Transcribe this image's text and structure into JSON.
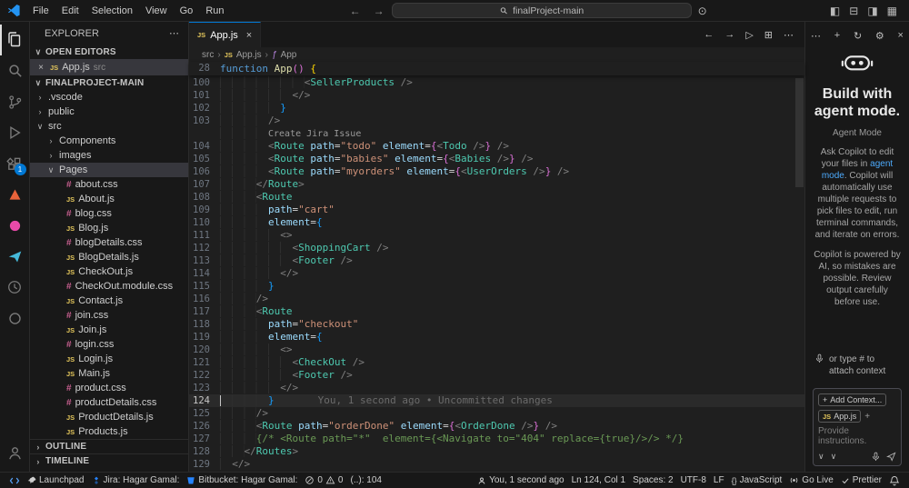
{
  "glyphs": {
    "js": "JS",
    "css": "#",
    "close": "×",
    "more": "⋯",
    "chev_down": "∨",
    "chev_right": "›",
    "back": "←",
    "fwd": "→",
    "plus": "+",
    "copilot": "⊙"
  },
  "titlebar": {
    "menus": [
      "File",
      "Edit",
      "Selection",
      "View",
      "Go",
      "Run"
    ],
    "search_value": "finalProject-main",
    "layout_icons": [
      {
        "id": "toggle-sidebar",
        "g": "◧"
      },
      {
        "id": "toggle-panel",
        "g": "⊟"
      },
      {
        "id": "toggle-secondary-sidebar",
        "g": "◨"
      },
      {
        "id": "customize-layout",
        "g": "▦"
      }
    ]
  },
  "activitybar": {
    "items": [
      {
        "id": "explorer",
        "icon": "files",
        "active": true
      },
      {
        "id": "search",
        "icon": "search"
      },
      {
        "id": "source-control",
        "icon": "scm"
      },
      {
        "id": "run-and-debug",
        "icon": "debug"
      },
      {
        "id": "extensions",
        "icon": "extensions",
        "badge": "1"
      },
      {
        "id": "jira",
        "icon": "tri",
        "color": "#e8633a"
      },
      {
        "id": "pink-extension",
        "icon": "dot",
        "color": "#ea4aaa"
      },
      {
        "id": "rest-client",
        "icon": "plane",
        "color": "#45b8d8"
      },
      {
        "id": "clock-extension",
        "icon": "clock"
      },
      {
        "id": "circle-extension",
        "icon": "ring"
      }
    ],
    "bottom": [
      {
        "id": "account",
        "icon": "account"
      }
    ]
  },
  "explorer": {
    "title": "EXPLORER",
    "open_editors_label": "OPEN EDITORS",
    "open_editors": [
      {
        "name": "App.js",
        "detail": "src",
        "icon": "js",
        "active": true
      }
    ],
    "project_label": "FINALPROJECT-MAIN",
    "tree": [
      {
        "label": ".vscode",
        "kind": "folder",
        "level": 0
      },
      {
        "label": "public",
        "kind": "folder",
        "level": 0
      },
      {
        "label": "src",
        "kind": "folder",
        "level": 0,
        "expanded": true
      },
      {
        "label": "Components",
        "kind": "folder",
        "level": 1
      },
      {
        "label": "images",
        "kind": "folder",
        "level": 1
      },
      {
        "label": "Pages",
        "kind": "folder",
        "level": 1,
        "expanded": true,
        "selected": true
      },
      {
        "label": "about.css",
        "kind": "css",
        "level": 2
      },
      {
        "label": "About.js",
        "kind": "js",
        "level": 2
      },
      {
        "label": "blog.css",
        "kind": "css",
        "level": 2
      },
      {
        "label": "Blog.js",
        "kind": "js",
        "level": 2
      },
      {
        "label": "blogDetails.css",
        "kind": "css",
        "level": 2
      },
      {
        "label": "BlogDetails.js",
        "kind": "js",
        "level": 2
      },
      {
        "label": "CheckOut.js",
        "kind": "js",
        "level": 2
      },
      {
        "label": "CheckOut.module.css",
        "kind": "css",
        "level": 2
      },
      {
        "label": "Contact.js",
        "kind": "js",
        "level": 2
      },
      {
        "label": "join.css",
        "kind": "css",
        "level": 2
      },
      {
        "label": "Join.js",
        "kind": "js",
        "level": 2
      },
      {
        "label": "login.css",
        "kind": "css",
        "level": 2
      },
      {
        "label": "Login.js",
        "kind": "js",
        "level": 2
      },
      {
        "label": "Main.js",
        "kind": "js",
        "level": 2
      },
      {
        "label": "product.css",
        "kind": "css",
        "level": 2
      },
      {
        "label": "productDetails.css",
        "kind": "css",
        "level": 2
      },
      {
        "label": "ProductDetails.js",
        "kind": "js",
        "level": 2
      },
      {
        "label": "Products.js",
        "kind": "js",
        "level": 2
      }
    ],
    "outline_label": "OUTLINE",
    "timeline_label": "TIMELINE"
  },
  "editor": {
    "tab": {
      "name": "App.js"
    },
    "actions": [
      {
        "id": "nav-back",
        "g": "←"
      },
      {
        "id": "nav-forward",
        "g": "→"
      },
      {
        "id": "run",
        "g": "▷"
      },
      {
        "id": "split-editor",
        "g": "⊞"
      },
      {
        "id": "more-actions",
        "g": "⋯"
      }
    ],
    "breadcrumb": [
      {
        "label": "src"
      },
      {
        "label": "App.js",
        "icon": "js"
      },
      {
        "label": "App",
        "icon": "symbol"
      }
    ],
    "sticky": {
      "num": "28",
      "tokens": [
        {
          "t": "function",
          "c": "kw"
        },
        {
          "t": " ",
          "c": "pl"
        },
        {
          "t": "App",
          "c": "fn"
        },
        {
          "t": "()",
          "c": "b2"
        },
        {
          "t": " ",
          "c": "pl"
        },
        {
          "t": "{",
          "c": "b1"
        }
      ]
    },
    "codelens": "Create Jira Issue",
    "blame": "You, 1 second ago • Uncommitted changes",
    "lines": [
      {
        "n": "100",
        "tk": [
          {
            "t": "              <",
            "c": "pu"
          },
          {
            "t": "SellerProducts",
            "c": "cp"
          },
          {
            "t": " />",
            "c": "pu"
          }
        ]
      },
      {
        "n": "101",
        "tk": [
          {
            "t": "            </>",
            "c": "pu"
          }
        ]
      },
      {
        "n": "102",
        "tk": [
          {
            "t": "          ",
            "c": "pl"
          },
          {
            "t": "}",
            "c": "b3"
          }
        ]
      },
      {
        "n": "103",
        "tk": [
          {
            "t": "        />",
            "c": "pu"
          }
        ]
      },
      {
        "lens": true
      },
      {
        "n": "104",
        "tk": [
          {
            "t": "        <",
            "c": "pu"
          },
          {
            "t": "Route",
            "c": "cp"
          },
          {
            "t": " ",
            "c": "pl"
          },
          {
            "t": "path",
            "c": "at"
          },
          {
            "t": "=",
            "c": "pl"
          },
          {
            "t": "\"todo\"",
            "c": "st"
          },
          {
            "t": " ",
            "c": "pl"
          },
          {
            "t": "element",
            "c": "at"
          },
          {
            "t": "=",
            "c": "pl"
          },
          {
            "t": "{",
            "c": "b2"
          },
          {
            "t": "<",
            "c": "pu"
          },
          {
            "t": "Todo",
            "c": "cp"
          },
          {
            "t": " />",
            "c": "pu"
          },
          {
            "t": "}",
            "c": "b2"
          },
          {
            "t": " />",
            "c": "pu"
          }
        ]
      },
      {
        "n": "105",
        "tk": [
          {
            "t": "        <",
            "c": "pu"
          },
          {
            "t": "Route",
            "c": "cp"
          },
          {
            "t": " ",
            "c": "pl"
          },
          {
            "t": "path",
            "c": "at"
          },
          {
            "t": "=",
            "c": "pl"
          },
          {
            "t": "\"babies\"",
            "c": "st"
          },
          {
            "t": " ",
            "c": "pl"
          },
          {
            "t": "element",
            "c": "at"
          },
          {
            "t": "=",
            "c": "pl"
          },
          {
            "t": "{",
            "c": "b2"
          },
          {
            "t": "<",
            "c": "pu"
          },
          {
            "t": "Babies",
            "c": "cp"
          },
          {
            "t": " />",
            "c": "pu"
          },
          {
            "t": "}",
            "c": "b2"
          },
          {
            "t": " />",
            "c": "pu"
          }
        ]
      },
      {
        "n": "106",
        "tk": [
          {
            "t": "        <",
            "c": "pu"
          },
          {
            "t": "Route",
            "c": "cp"
          },
          {
            "t": " ",
            "c": "pl"
          },
          {
            "t": "path",
            "c": "at"
          },
          {
            "t": "=",
            "c": "pl"
          },
          {
            "t": "\"myorders\"",
            "c": "st"
          },
          {
            "t": " ",
            "c": "pl"
          },
          {
            "t": "element",
            "c": "at"
          },
          {
            "t": "=",
            "c": "pl"
          },
          {
            "t": "{",
            "c": "b2"
          },
          {
            "t": "<",
            "c": "pu"
          },
          {
            "t": "UserOrders",
            "c": "cp"
          },
          {
            "t": " />",
            "c": "pu"
          },
          {
            "t": "}",
            "c": "b2"
          },
          {
            "t": " />",
            "c": "pu"
          }
        ]
      },
      {
        "n": "107",
        "tk": [
          {
            "t": "      </",
            "c": "pu"
          },
          {
            "t": "Route",
            "c": "cp"
          },
          {
            "t": ">",
            "c": "pu"
          }
        ]
      },
      {
        "n": "108",
        "tk": [
          {
            "t": "      <",
            "c": "pu"
          },
          {
            "t": "Route",
            "c": "cp"
          }
        ]
      },
      {
        "n": "109",
        "tk": [
          {
            "t": "        ",
            "c": "pl"
          },
          {
            "t": "path",
            "c": "at"
          },
          {
            "t": "=",
            "c": "pl"
          },
          {
            "t": "\"cart\"",
            "c": "st"
          }
        ]
      },
      {
        "n": "110",
        "tk": [
          {
            "t": "        ",
            "c": "pl"
          },
          {
            "t": "element",
            "c": "at"
          },
          {
            "t": "=",
            "c": "pl"
          },
          {
            "t": "{",
            "c": "b3"
          }
        ]
      },
      {
        "n": "111",
        "tk": [
          {
            "t": "          <>",
            "c": "pu"
          }
        ]
      },
      {
        "n": "112",
        "tk": [
          {
            "t": "            <",
            "c": "pu"
          },
          {
            "t": "ShoppingCart",
            "c": "cp"
          },
          {
            "t": " />",
            "c": "pu"
          }
        ]
      },
      {
        "n": "113",
        "tk": [
          {
            "t": "            <",
            "c": "pu"
          },
          {
            "t": "Footer",
            "c": "cp"
          },
          {
            "t": " />",
            "c": "pu"
          }
        ]
      },
      {
        "n": "114",
        "tk": [
          {
            "t": "          </>",
            "c": "pu"
          }
        ]
      },
      {
        "n": "115",
        "tk": [
          {
            "t": "        ",
            "c": "pl"
          },
          {
            "t": "}",
            "c": "b3"
          }
        ]
      },
      {
        "n": "116",
        "tk": [
          {
            "t": "      />",
            "c": "pu"
          }
        ]
      },
      {
        "n": "117",
        "tk": [
          {
            "t": "      <",
            "c": "pu"
          },
          {
            "t": "Route",
            "c": "cp"
          }
        ]
      },
      {
        "n": "118",
        "tk": [
          {
            "t": "        ",
            "c": "pl"
          },
          {
            "t": "path",
            "c": "at"
          },
          {
            "t": "=",
            "c": "pl"
          },
          {
            "t": "\"checkout\"",
            "c": "st"
          }
        ]
      },
      {
        "n": "119",
        "tk": [
          {
            "t": "        ",
            "c": "pl"
          },
          {
            "t": "element",
            "c": "at"
          },
          {
            "t": "=",
            "c": "pl"
          },
          {
            "t": "{",
            "c": "b3"
          }
        ]
      },
      {
        "n": "120",
        "tk": [
          {
            "t": "          <>",
            "c": "pu"
          }
        ]
      },
      {
        "n": "121",
        "tk": [
          {
            "t": "            <",
            "c": "pu"
          },
          {
            "t": "CheckOut",
            "c": "cp"
          },
          {
            "t": " />",
            "c": "pu"
          }
        ]
      },
      {
        "n": "122",
        "tk": [
          {
            "t": "            <",
            "c": "pu"
          },
          {
            "t": "Footer",
            "c": "cp"
          },
          {
            "t": " />",
            "c": "pu"
          }
        ]
      },
      {
        "n": "123",
        "tk": [
          {
            "t": "          </>",
            "c": "pu"
          }
        ]
      },
      {
        "n": "124",
        "cur": true,
        "blame": true,
        "tk": [
          {
            "t": "        ",
            "c": "pl"
          },
          {
            "t": "}",
            "c": "b3"
          }
        ]
      },
      {
        "n": "125",
        "tk": [
          {
            "t": "      />",
            "c": "pu"
          }
        ]
      },
      {
        "n": "126",
        "tk": [
          {
            "t": "      <",
            "c": "pu"
          },
          {
            "t": "Route",
            "c": "cp"
          },
          {
            "t": " ",
            "c": "pl"
          },
          {
            "t": "path",
            "c": "at"
          },
          {
            "t": "=",
            "c": "pl"
          },
          {
            "t": "\"orderDone\"",
            "c": "st"
          },
          {
            "t": " ",
            "c": "pl"
          },
          {
            "t": "element",
            "c": "at"
          },
          {
            "t": "=",
            "c": "pl"
          },
          {
            "t": "{",
            "c": "b2"
          },
          {
            "t": "<",
            "c": "pu"
          },
          {
            "t": "OrderDone",
            "c": "cp"
          },
          {
            "t": " />",
            "c": "pu"
          },
          {
            "t": "}",
            "c": "b2"
          },
          {
            "t": " />",
            "c": "pu"
          }
        ]
      },
      {
        "n": "127",
        "tk": [
          {
            "t": "      ",
            "c": "pl"
          },
          {
            "t": "{/* <Route path=\"*\"  element={<Navigate to=\"404\" replace={true}/>/> */}",
            "c": "cm"
          }
        ]
      },
      {
        "n": "128",
        "tk": [
          {
            "t": "    </",
            "c": "pu"
          },
          {
            "t": "Routes",
            "c": "cp"
          },
          {
            "t": ">",
            "c": "pu"
          }
        ]
      },
      {
        "n": "129",
        "tk": [
          {
            "t": "  </>",
            "c": "pu"
          }
        ]
      }
    ]
  },
  "copilot": {
    "header_icons": [
      {
        "id": "more-actions",
        "g": "⋯"
      },
      {
        "id": "new-chat",
        "g": "+"
      },
      {
        "id": "chat-history",
        "g": "↻"
      },
      {
        "id": "settings",
        "g": "⚙"
      },
      {
        "id": "close-panel",
        "g": "×"
      }
    ],
    "title_line1": "Build with",
    "title_line2": "agent mode.",
    "subtitle": "Agent Mode",
    "p1_pre": "Ask Copilot to edit your files in ",
    "p1_link": "agent mode",
    "p1_post": ". Copilot will automatically use multiple requests to pick files to edit, run terminal commands, and iterate on errors.",
    "p2": "Copilot is powered by AI, so mistakes are possible. Review output carefully before use.",
    "hint": "or type # to attach context",
    "add_context": "Add Context...",
    "file_chip": "App.js",
    "placeholder": "Provide instructions.",
    "accent": "#4daafc"
  },
  "statusbar": {
    "left": [
      {
        "id": "remote",
        "icon": "remote"
      },
      {
        "id": "launchpad",
        "icon": "rocket",
        "text": "Launchpad"
      },
      {
        "id": "jira",
        "icon": "jira",
        "text": "Jira: Hagar Gamal:"
      },
      {
        "id": "bitbucket",
        "icon": "bitbucket",
        "text": "Bitbucket: Hagar Gamal:"
      },
      {
        "id": "problems",
        "icon": "error",
        "text": "0",
        "icon2": "warn",
        "text2": "0"
      },
      {
        "id": "counter",
        "text": "(..): 104"
      }
    ],
    "right": [
      {
        "id": "git-blame",
        "icon": "person",
        "text": "You, 1 second ago"
      },
      {
        "id": "cursor-position",
        "text": "Ln 124, Col 1"
      },
      {
        "id": "indentation",
        "text": "Spaces: 2"
      },
      {
        "id": "encoding",
        "text": "UTF-8"
      },
      {
        "id": "eol",
        "text": "LF"
      },
      {
        "id": "language",
        "icon": "braces",
        "text": "JavaScript"
      },
      {
        "id": "go-live",
        "icon": "broadcast",
        "text": "Go Live"
      },
      {
        "id": "prettier",
        "icon": "check",
        "text": "Prettier"
      },
      {
        "id": "notifications",
        "icon": "bell"
      }
    ]
  }
}
